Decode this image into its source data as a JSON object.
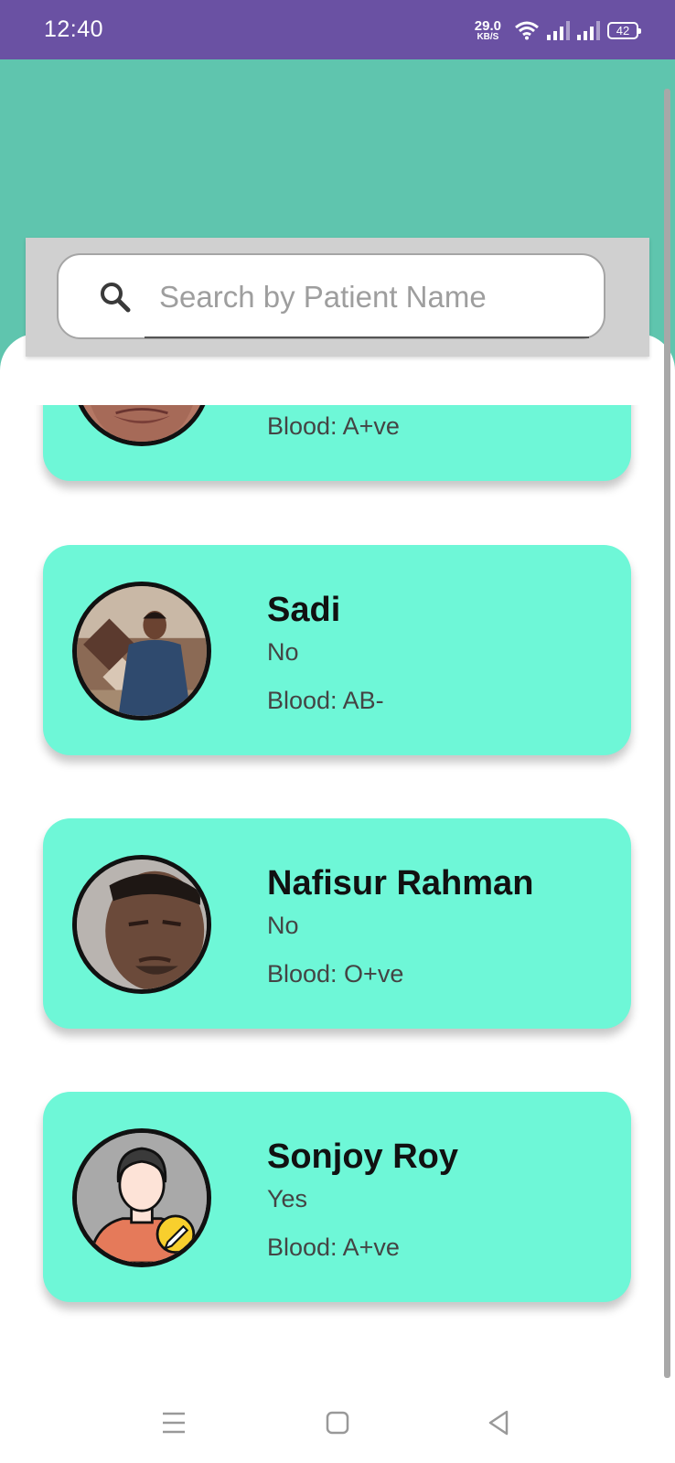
{
  "status_bar": {
    "time": "12:40",
    "net_speed_value": "29.0",
    "net_speed_unit": "KB/S",
    "battery": "42"
  },
  "search": {
    "placeholder": "Search by Patient Name",
    "value": ""
  },
  "patients": [
    {
      "name": "",
      "status": "",
      "blood": "Blood: A+ve",
      "avatar": "photo"
    },
    {
      "name": "Sadi",
      "status": "No",
      "blood": "Blood: AB-",
      "avatar": "photo"
    },
    {
      "name": "Nafisur Rahman",
      "status": "No",
      "blood": "Blood: O+ve",
      "avatar": "photo"
    },
    {
      "name": "Sonjoy Roy",
      "status": "Yes",
      "blood": "Blood: A+ve",
      "avatar": "default-user-edit-icon"
    }
  ],
  "colors": {
    "status_bar": "#6a51a3",
    "header": "#5fc5ae",
    "card": "#6ef7d7"
  },
  "nav": {
    "icons": [
      "menu-icon",
      "home-icon",
      "back-icon"
    ]
  }
}
